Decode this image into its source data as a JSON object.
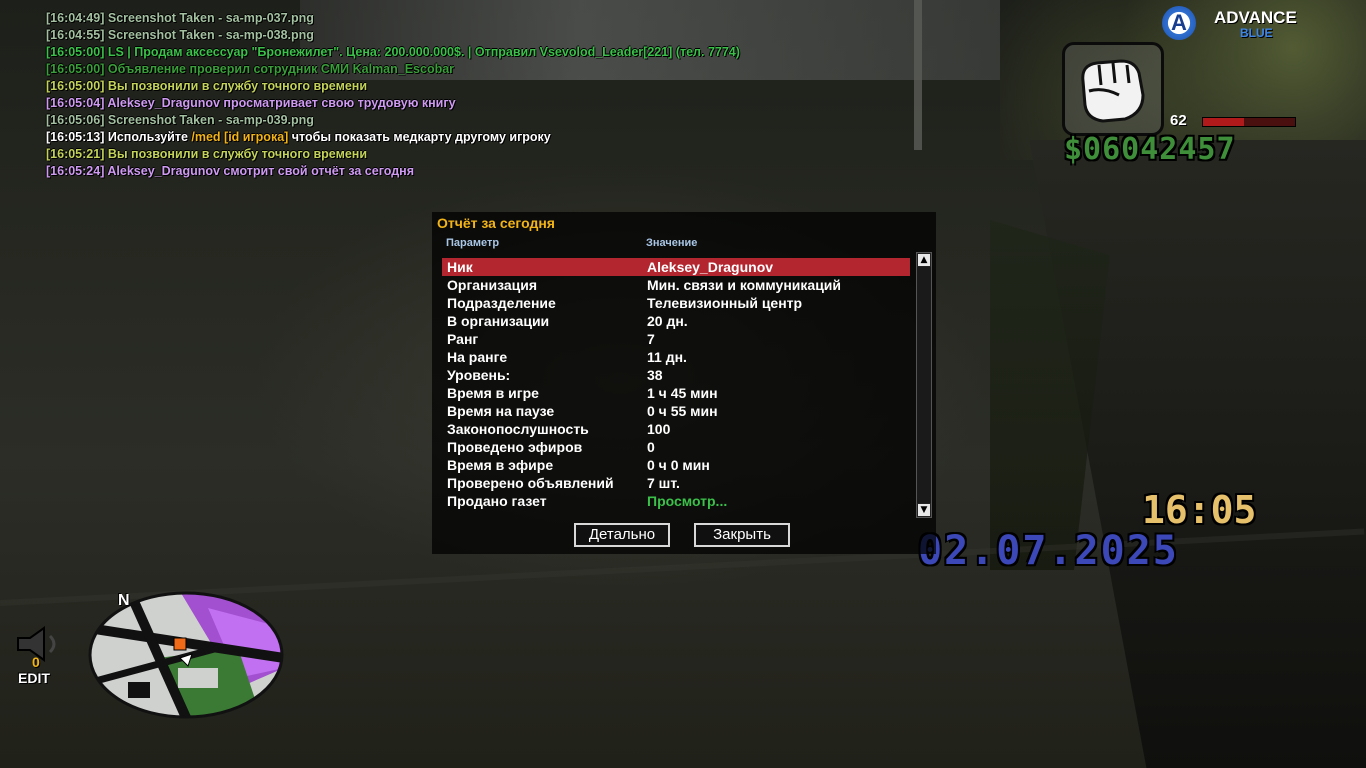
{
  "chat": [
    {
      "time": "[16:04:49]",
      "text": "Screenshot Taken - sa-mp-037.png",
      "color": "#a3c0a0"
    },
    {
      "time": "[16:04:55]",
      "text": "Screenshot Taken - sa-mp-038.png",
      "color": "#a3c0a0"
    },
    {
      "time": "[16:05:00]",
      "text": "LS | Продам аксессуар \"Бронежилет\". Цена: 200.000.000$. | Отправил Vsevolod_Leader[221] (тел. 7774)",
      "color": "#3bc14a"
    },
    {
      "time": "[16:05:00]",
      "text": "   Объявление проверил сотрудник СМИ Kalman_Escobar",
      "color": "#3a9e3a"
    },
    {
      "time": "[16:05:00]",
      "text": "Вы позвонили в службу точного времени",
      "color": "#c3d35a"
    },
    {
      "time": "[16:05:04]",
      "text": "Aleksey_Dragunov просматривает свою трудовую книгу",
      "color": "#cf9af2"
    },
    {
      "time": "[16:05:06]",
      "text": "Screenshot Taken - sa-mp-039.png",
      "color": "#a3c0a0"
    },
    {
      "time": "[16:05:13]",
      "text_before": "Используйте ",
      "highlight": "/med [id игрока]",
      "text_after": " чтобы показать медкарту другому игроку",
      "color": "#ffffff",
      "highlight_color": "#f2b417"
    },
    {
      "time": "[16:05:21]",
      "text": "Вы позвонили в службу точного времени",
      "color": "#c3d35a"
    },
    {
      "time": "[16:05:24]",
      "text": "Aleksey_Dragunov смотрит свой отчёт за сегодня",
      "color": "#cf9af2"
    }
  ],
  "logo": {
    "letter": "A",
    "title": "ADVANCE",
    "subtitle": "BLUE"
  },
  "hud": {
    "ammo": "62",
    "health_fraction": 0.45,
    "money": "$06042457",
    "clock": "16:05",
    "date": "02.07.2025"
  },
  "dialog": {
    "title": "Отчёт за сегодня",
    "col_param": "Параметр",
    "col_value": "Значение",
    "rows": [
      {
        "param": "Ник",
        "value": "Aleksey_Dragunov"
      },
      {
        "param": "Организация",
        "value": "Мин. связи и коммуникаций"
      },
      {
        "param": "Подразделение",
        "value": "Телевизионный центр"
      },
      {
        "param": "В организации",
        "value": "20 дн."
      },
      {
        "param": "Ранг",
        "value": "7"
      },
      {
        "param": "На ранге",
        "value": "11 дн."
      },
      {
        "param": "Уровень:",
        "value": "38"
      },
      {
        "param": "Время в игре",
        "value": "1 ч 45 мин"
      },
      {
        "param": "Время на паузе",
        "value": "0 ч 55 мин"
      },
      {
        "param": "Законопослушность",
        "value": "100"
      },
      {
        "param": "Проведено эфиров",
        "value": "0"
      },
      {
        "param": "Время в эфире",
        "value": "0 ч 0 мин"
      },
      {
        "param": "Проверено объявлений",
        "value": "7 шт."
      },
      {
        "param": "Продано газет",
        "value": "Просмотр..."
      }
    ],
    "button_details": "Детально",
    "button_close": "Закрыть"
  },
  "minimap": {
    "north": "N"
  },
  "radio": {
    "count": "0",
    "label": "EDIT"
  },
  "colors": {
    "accent_title": "#f2b417",
    "selected_row": "#b3262f",
    "link": "#3bc14a"
  }
}
